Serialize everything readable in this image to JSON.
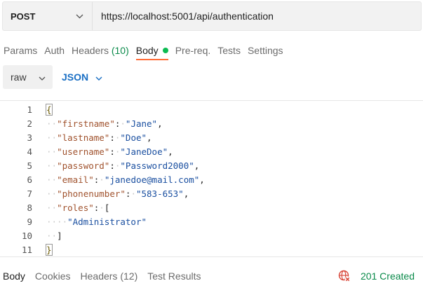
{
  "request": {
    "method": "POST",
    "url": "https://localhost:5001/api/authentication"
  },
  "request_tabs": [
    {
      "label": "Params"
    },
    {
      "label": "Auth"
    },
    {
      "label": "Headers",
      "count": "(10)"
    },
    {
      "label": "Body",
      "active": true
    },
    {
      "label": "Pre-req."
    },
    {
      "label": "Tests"
    },
    {
      "label": "Settings"
    }
  ],
  "body_options": {
    "mode": "raw",
    "language": "JSON"
  },
  "editor": {
    "line_numbers": [
      "1",
      "2",
      "3",
      "4",
      "5",
      "6",
      "7",
      "8",
      "9",
      "10",
      "11"
    ],
    "lines": [
      {
        "open": "{"
      },
      {
        "key": "\"firstname\"",
        "value": "\"Jane\""
      },
      {
        "key": "\"lastname\"",
        "value": "\"Doe\""
      },
      {
        "key": "\"username\"",
        "value": "\"JaneDoe\""
      },
      {
        "key": "\"password\"",
        "value": "\"Password2000\""
      },
      {
        "key": "\"email\"",
        "value": "\"janedoe@mail.com\""
      },
      {
        "key": "\"phonenumber\"",
        "value": "\"583-653\""
      },
      {
        "key": "\"roles\"",
        "value": "["
      },
      {
        "item": "\"Administrator\""
      },
      {
        "close": "]"
      },
      {
        "close": "}"
      }
    ]
  },
  "response_tabs": [
    {
      "label": "Body",
      "active": true
    },
    {
      "label": "Cookies"
    },
    {
      "label": "Headers",
      "count": "(12)"
    },
    {
      "label": "Test Results"
    }
  ],
  "response_status": {
    "text": "201 Created",
    "color": "#0a8a4a",
    "icon": "globe-cross-icon"
  },
  "colors": {
    "accent": "#ff6c37",
    "json_blue": "#1a6fc4",
    "status_green": "#0a8a4a"
  }
}
